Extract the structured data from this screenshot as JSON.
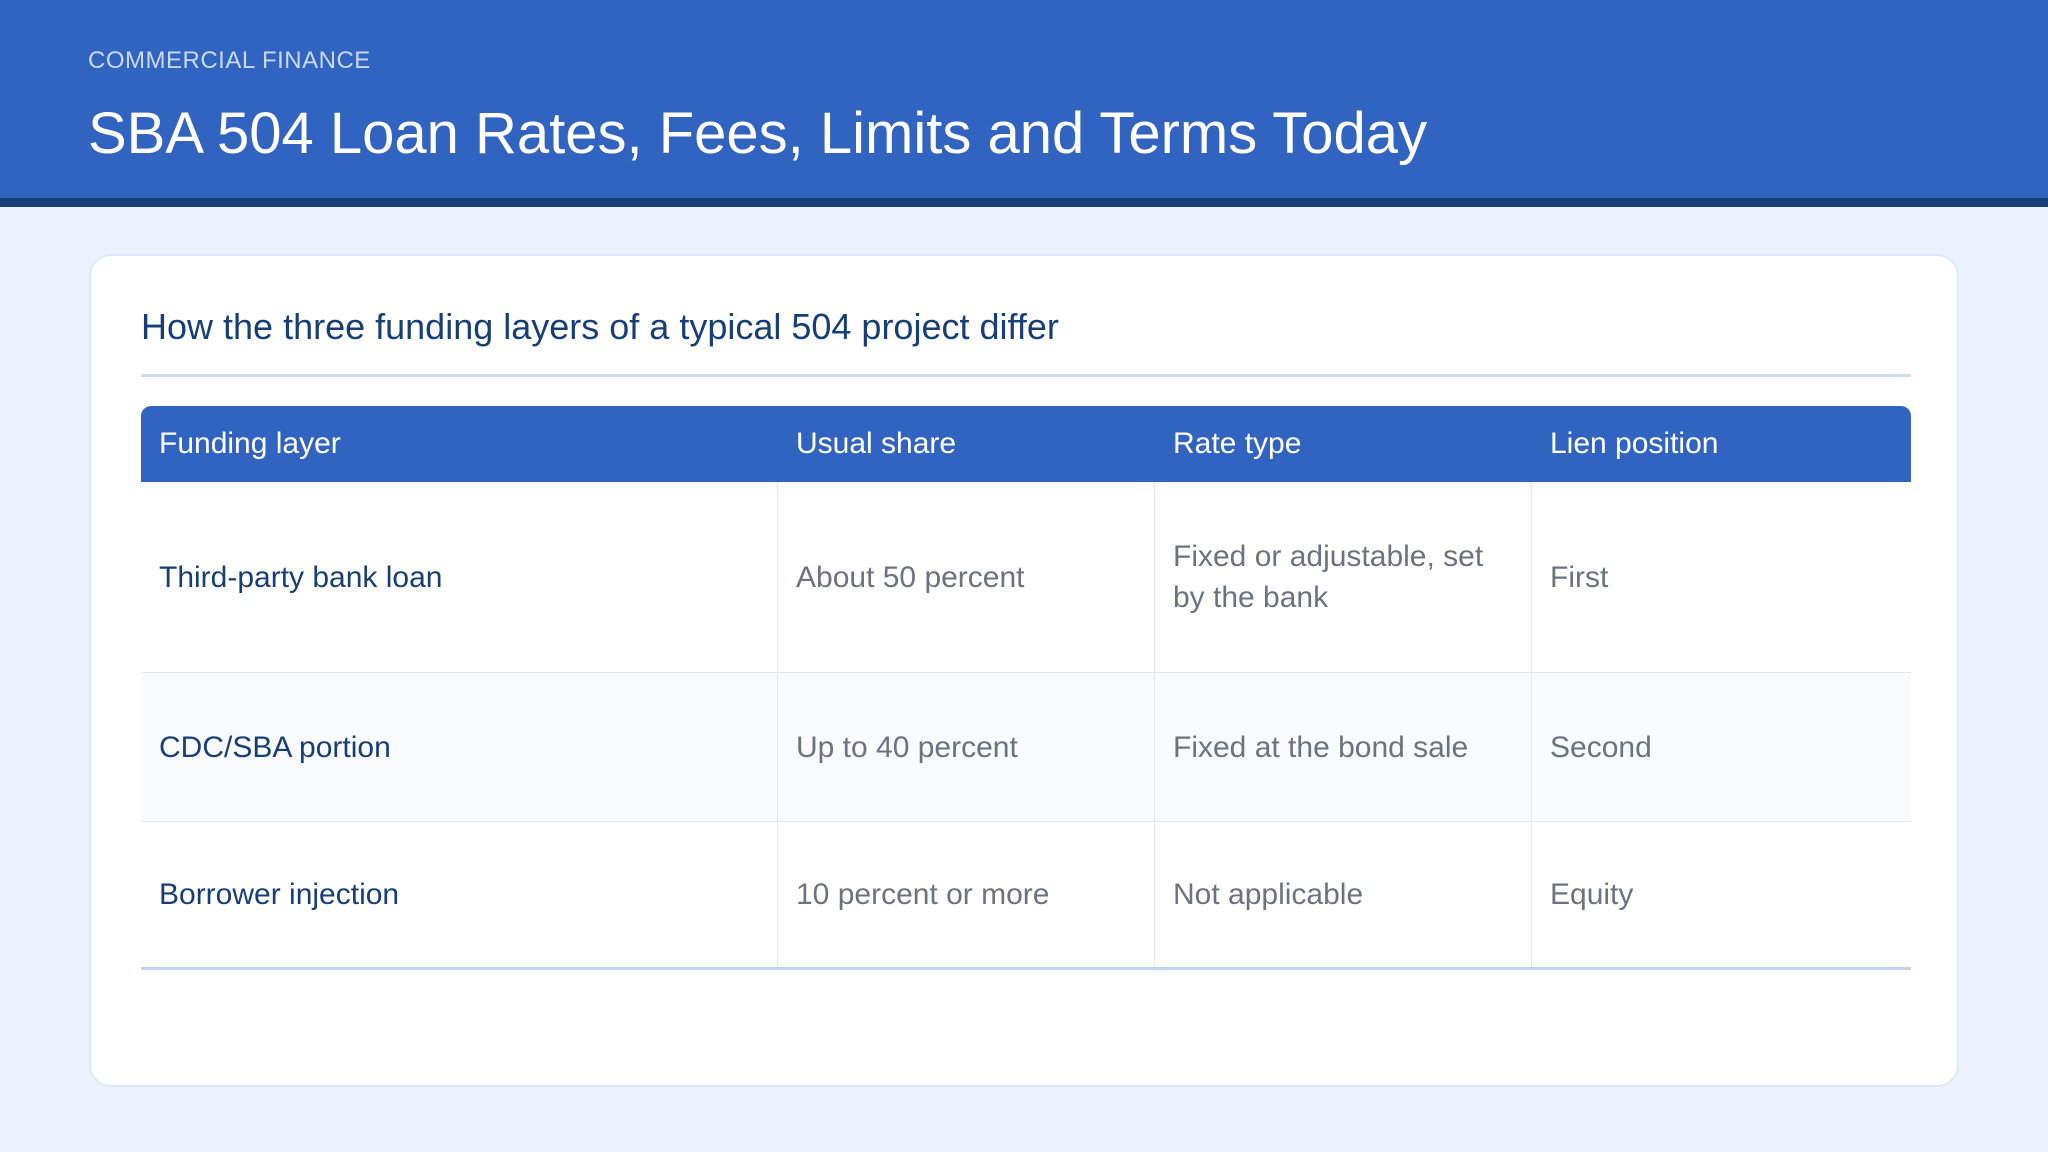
{
  "header": {
    "kicker": "COMMERCIAL FINANCE",
    "title": "SBA 504 Loan Rates, Fees, Limits and Terms Today"
  },
  "card": {
    "title": "How the three funding layers of a typical 504 project differ"
  },
  "table": {
    "columns": [
      "Funding layer",
      "Usual share",
      "Rate type",
      "Lien position"
    ],
    "rows": [
      [
        "Third-party bank loan",
        "About 50 percent",
        "Fixed or adjustable, set by the bank",
        "First"
      ],
      [
        "CDC/SBA portion",
        "Up to 40 percent",
        "Fixed at the bond sale",
        "Second"
      ],
      [
        "Borrower injection",
        "10 percent or more",
        "Not applicable",
        "Equity"
      ]
    ]
  },
  "colors": {
    "header_bg": "#3164c1",
    "header_border": "#163f78",
    "page_bg": "#ebf2fd",
    "accent_text": "#163f78"
  }
}
